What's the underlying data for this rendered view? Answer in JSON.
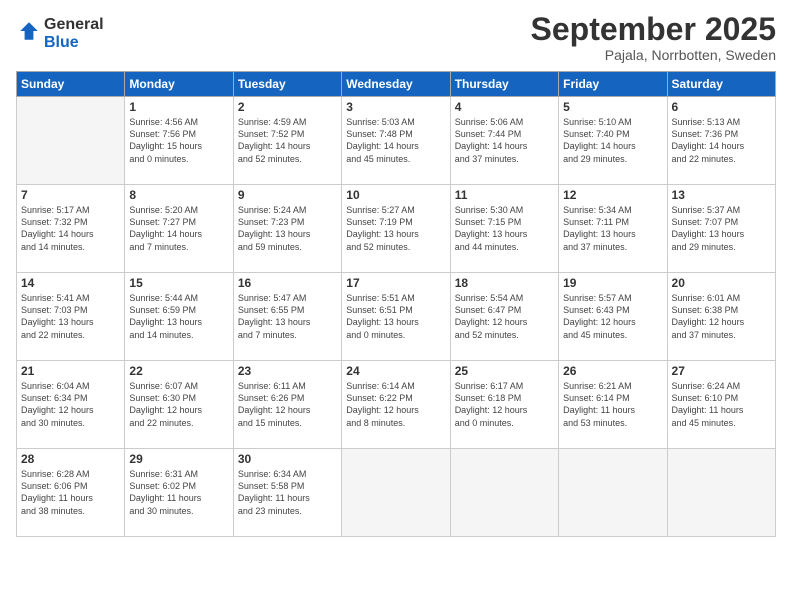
{
  "logo": {
    "line1": "General",
    "line2": "Blue"
  },
  "title": "September 2025",
  "location": "Pajala, Norrbotten, Sweden",
  "header": {
    "days": [
      "Sunday",
      "Monday",
      "Tuesday",
      "Wednesday",
      "Thursday",
      "Friday",
      "Saturday"
    ]
  },
  "weeks": [
    [
      {
        "day": "",
        "info": ""
      },
      {
        "day": "1",
        "info": "Sunrise: 4:56 AM\nSunset: 7:56 PM\nDaylight: 15 hours\nand 0 minutes."
      },
      {
        "day": "2",
        "info": "Sunrise: 4:59 AM\nSunset: 7:52 PM\nDaylight: 14 hours\nand 52 minutes."
      },
      {
        "day": "3",
        "info": "Sunrise: 5:03 AM\nSunset: 7:48 PM\nDaylight: 14 hours\nand 45 minutes."
      },
      {
        "day": "4",
        "info": "Sunrise: 5:06 AM\nSunset: 7:44 PM\nDaylight: 14 hours\nand 37 minutes."
      },
      {
        "day": "5",
        "info": "Sunrise: 5:10 AM\nSunset: 7:40 PM\nDaylight: 14 hours\nand 29 minutes."
      },
      {
        "day": "6",
        "info": "Sunrise: 5:13 AM\nSunset: 7:36 PM\nDaylight: 14 hours\nand 22 minutes."
      }
    ],
    [
      {
        "day": "7",
        "info": "Sunrise: 5:17 AM\nSunset: 7:32 PM\nDaylight: 14 hours\nand 14 minutes."
      },
      {
        "day": "8",
        "info": "Sunrise: 5:20 AM\nSunset: 7:27 PM\nDaylight: 14 hours\nand 7 minutes."
      },
      {
        "day": "9",
        "info": "Sunrise: 5:24 AM\nSunset: 7:23 PM\nDaylight: 13 hours\nand 59 minutes."
      },
      {
        "day": "10",
        "info": "Sunrise: 5:27 AM\nSunset: 7:19 PM\nDaylight: 13 hours\nand 52 minutes."
      },
      {
        "day": "11",
        "info": "Sunrise: 5:30 AM\nSunset: 7:15 PM\nDaylight: 13 hours\nand 44 minutes."
      },
      {
        "day": "12",
        "info": "Sunrise: 5:34 AM\nSunset: 7:11 PM\nDaylight: 13 hours\nand 37 minutes."
      },
      {
        "day": "13",
        "info": "Sunrise: 5:37 AM\nSunset: 7:07 PM\nDaylight: 13 hours\nand 29 minutes."
      }
    ],
    [
      {
        "day": "14",
        "info": "Sunrise: 5:41 AM\nSunset: 7:03 PM\nDaylight: 13 hours\nand 22 minutes."
      },
      {
        "day": "15",
        "info": "Sunrise: 5:44 AM\nSunset: 6:59 PM\nDaylight: 13 hours\nand 14 minutes."
      },
      {
        "day": "16",
        "info": "Sunrise: 5:47 AM\nSunset: 6:55 PM\nDaylight: 13 hours\nand 7 minutes."
      },
      {
        "day": "17",
        "info": "Sunrise: 5:51 AM\nSunset: 6:51 PM\nDaylight: 13 hours\nand 0 minutes."
      },
      {
        "day": "18",
        "info": "Sunrise: 5:54 AM\nSunset: 6:47 PM\nDaylight: 12 hours\nand 52 minutes."
      },
      {
        "day": "19",
        "info": "Sunrise: 5:57 AM\nSunset: 6:43 PM\nDaylight: 12 hours\nand 45 minutes."
      },
      {
        "day": "20",
        "info": "Sunrise: 6:01 AM\nSunset: 6:38 PM\nDaylight: 12 hours\nand 37 minutes."
      }
    ],
    [
      {
        "day": "21",
        "info": "Sunrise: 6:04 AM\nSunset: 6:34 PM\nDaylight: 12 hours\nand 30 minutes."
      },
      {
        "day": "22",
        "info": "Sunrise: 6:07 AM\nSunset: 6:30 PM\nDaylight: 12 hours\nand 22 minutes."
      },
      {
        "day": "23",
        "info": "Sunrise: 6:11 AM\nSunset: 6:26 PM\nDaylight: 12 hours\nand 15 minutes."
      },
      {
        "day": "24",
        "info": "Sunrise: 6:14 AM\nSunset: 6:22 PM\nDaylight: 12 hours\nand 8 minutes."
      },
      {
        "day": "25",
        "info": "Sunrise: 6:17 AM\nSunset: 6:18 PM\nDaylight: 12 hours\nand 0 minutes."
      },
      {
        "day": "26",
        "info": "Sunrise: 6:21 AM\nSunset: 6:14 PM\nDaylight: 11 hours\nand 53 minutes."
      },
      {
        "day": "27",
        "info": "Sunrise: 6:24 AM\nSunset: 6:10 PM\nDaylight: 11 hours\nand 45 minutes."
      }
    ],
    [
      {
        "day": "28",
        "info": "Sunrise: 6:28 AM\nSunset: 6:06 PM\nDaylight: 11 hours\nand 38 minutes."
      },
      {
        "day": "29",
        "info": "Sunrise: 6:31 AM\nSunset: 6:02 PM\nDaylight: 11 hours\nand 30 minutes."
      },
      {
        "day": "30",
        "info": "Sunrise: 6:34 AM\nSunset: 5:58 PM\nDaylight: 11 hours\nand 23 minutes."
      },
      {
        "day": "",
        "info": ""
      },
      {
        "day": "",
        "info": ""
      },
      {
        "day": "",
        "info": ""
      },
      {
        "day": "",
        "info": ""
      }
    ]
  ]
}
